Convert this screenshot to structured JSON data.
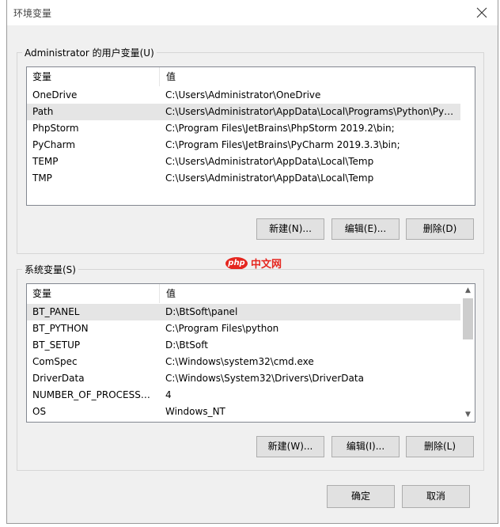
{
  "title": "环境变量",
  "user_group": {
    "label": "Administrator 的用户变量(U)",
    "columns": [
      "变量",
      "值"
    ],
    "rows": [
      [
        "OneDrive",
        "C:\\Users\\Administrator\\OneDrive"
      ],
      [
        "Path",
        "C:\\Users\\Administrator\\AppData\\Local\\Programs\\Python\\Pyt..."
      ],
      [
        "PhpStorm",
        "C:\\Program Files\\JetBrains\\PhpStorm 2019.2\\bin;"
      ],
      [
        "PyCharm",
        "C:\\Program Files\\JetBrains\\PyCharm 2019.3.3\\bin;"
      ],
      [
        "TEMP",
        "C:\\Users\\Administrator\\AppData\\Local\\Temp"
      ],
      [
        "TMP",
        "C:\\Users\\Administrator\\AppData\\Local\\Temp"
      ]
    ],
    "selected_index": 1,
    "buttons": {
      "new": "新建(N)...",
      "edit": "编辑(E)...",
      "delete": "删除(D)"
    }
  },
  "system_group": {
    "label": "系统变量(S)",
    "columns": [
      "变量",
      "值"
    ],
    "rows": [
      [
        "BT_PANEL",
        "D:\\BtSoft\\panel"
      ],
      [
        "BT_PYTHON",
        "C:\\Program Files\\python"
      ],
      [
        "BT_SETUP",
        "D:\\BtSoft"
      ],
      [
        "ComSpec",
        "C:\\Windows\\system32\\cmd.exe"
      ],
      [
        "DriverData",
        "C:\\Windows\\System32\\Drivers\\DriverData"
      ],
      [
        "NUMBER_OF_PROCESSORS",
        "4"
      ],
      [
        "OS",
        "Windows_NT"
      ]
    ],
    "selected_index": 0,
    "buttons": {
      "new": "新建(W)...",
      "edit": "编辑(I)...",
      "delete": "删除(L)"
    }
  },
  "footer": {
    "ok": "确定",
    "cancel": "取消"
  },
  "watermark": {
    "badge": "php",
    "text": "中文网"
  },
  "colors": {
    "selected_row": "#e5e5e5",
    "watermark": "#e5261f"
  },
  "icons": {
    "close": "close-icon",
    "scroll_up": "chevron-up-icon",
    "scroll_down": "chevron-down-icon"
  }
}
